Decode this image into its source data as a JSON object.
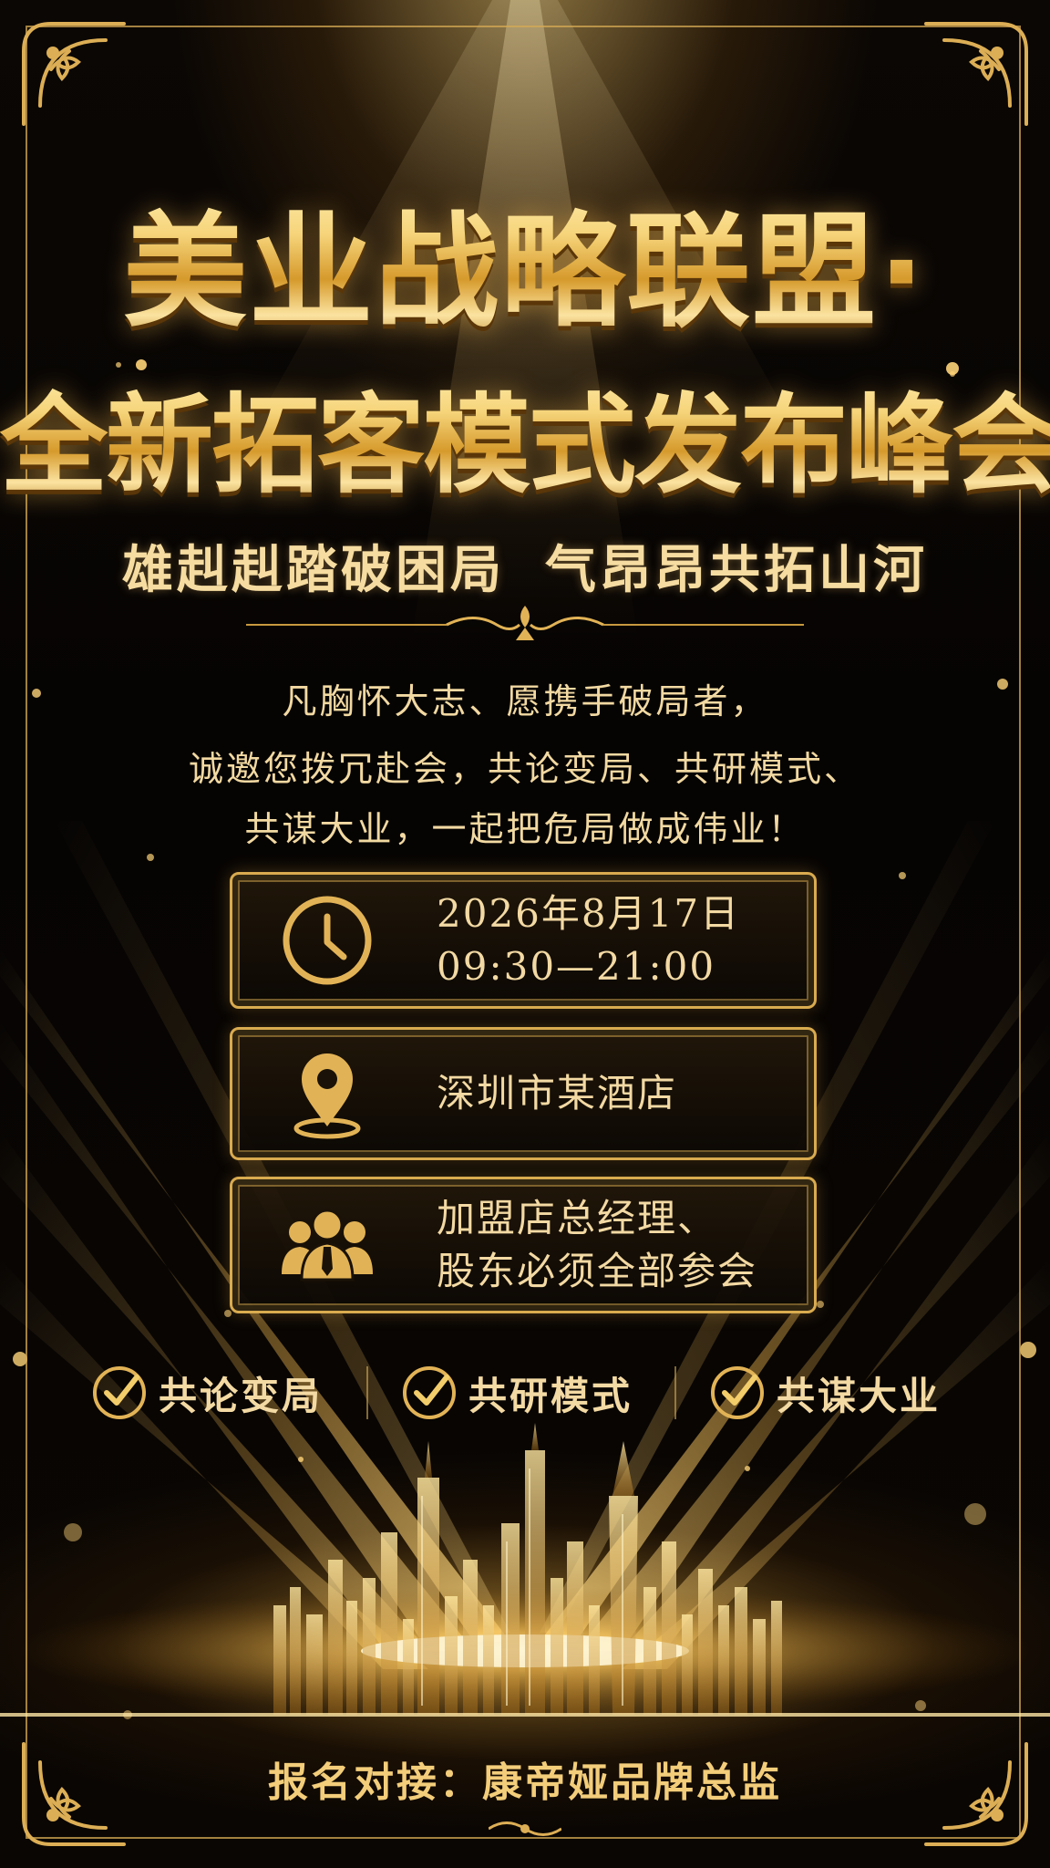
{
  "title": {
    "line1": "美业战略联盟·",
    "line2": "全新拓客模式发布峰会"
  },
  "slogan": {
    "left": "雄赳赳踏破困局",
    "right": "气昂昂共拓山河"
  },
  "invitation": [
    "凡胸怀大志、愿携手破局者，",
    "诚邀您拨冗赴会，共论变局、共研模式、",
    "共谋大业，一起把危局做成伟业！"
  ],
  "info": {
    "date": "2026年8月17日",
    "time": "09:30—21:00",
    "location": "深圳市某酒店",
    "attendees_line1": "加盟店总经理、",
    "attendees_line2": "股东必须全部参会"
  },
  "features": [
    "共论变局",
    "共研模式",
    "共谋大业"
  ],
  "contact": "报名对接：康帝娅品牌总监",
  "icons": {
    "time": "clock-icon",
    "location": "map-pin-icon",
    "attendees": "people-icon",
    "feature": "check-circle-icon"
  },
  "colors": {
    "gold": "#e2b356",
    "gold_light": "#f6dca0",
    "background": "#050302"
  }
}
